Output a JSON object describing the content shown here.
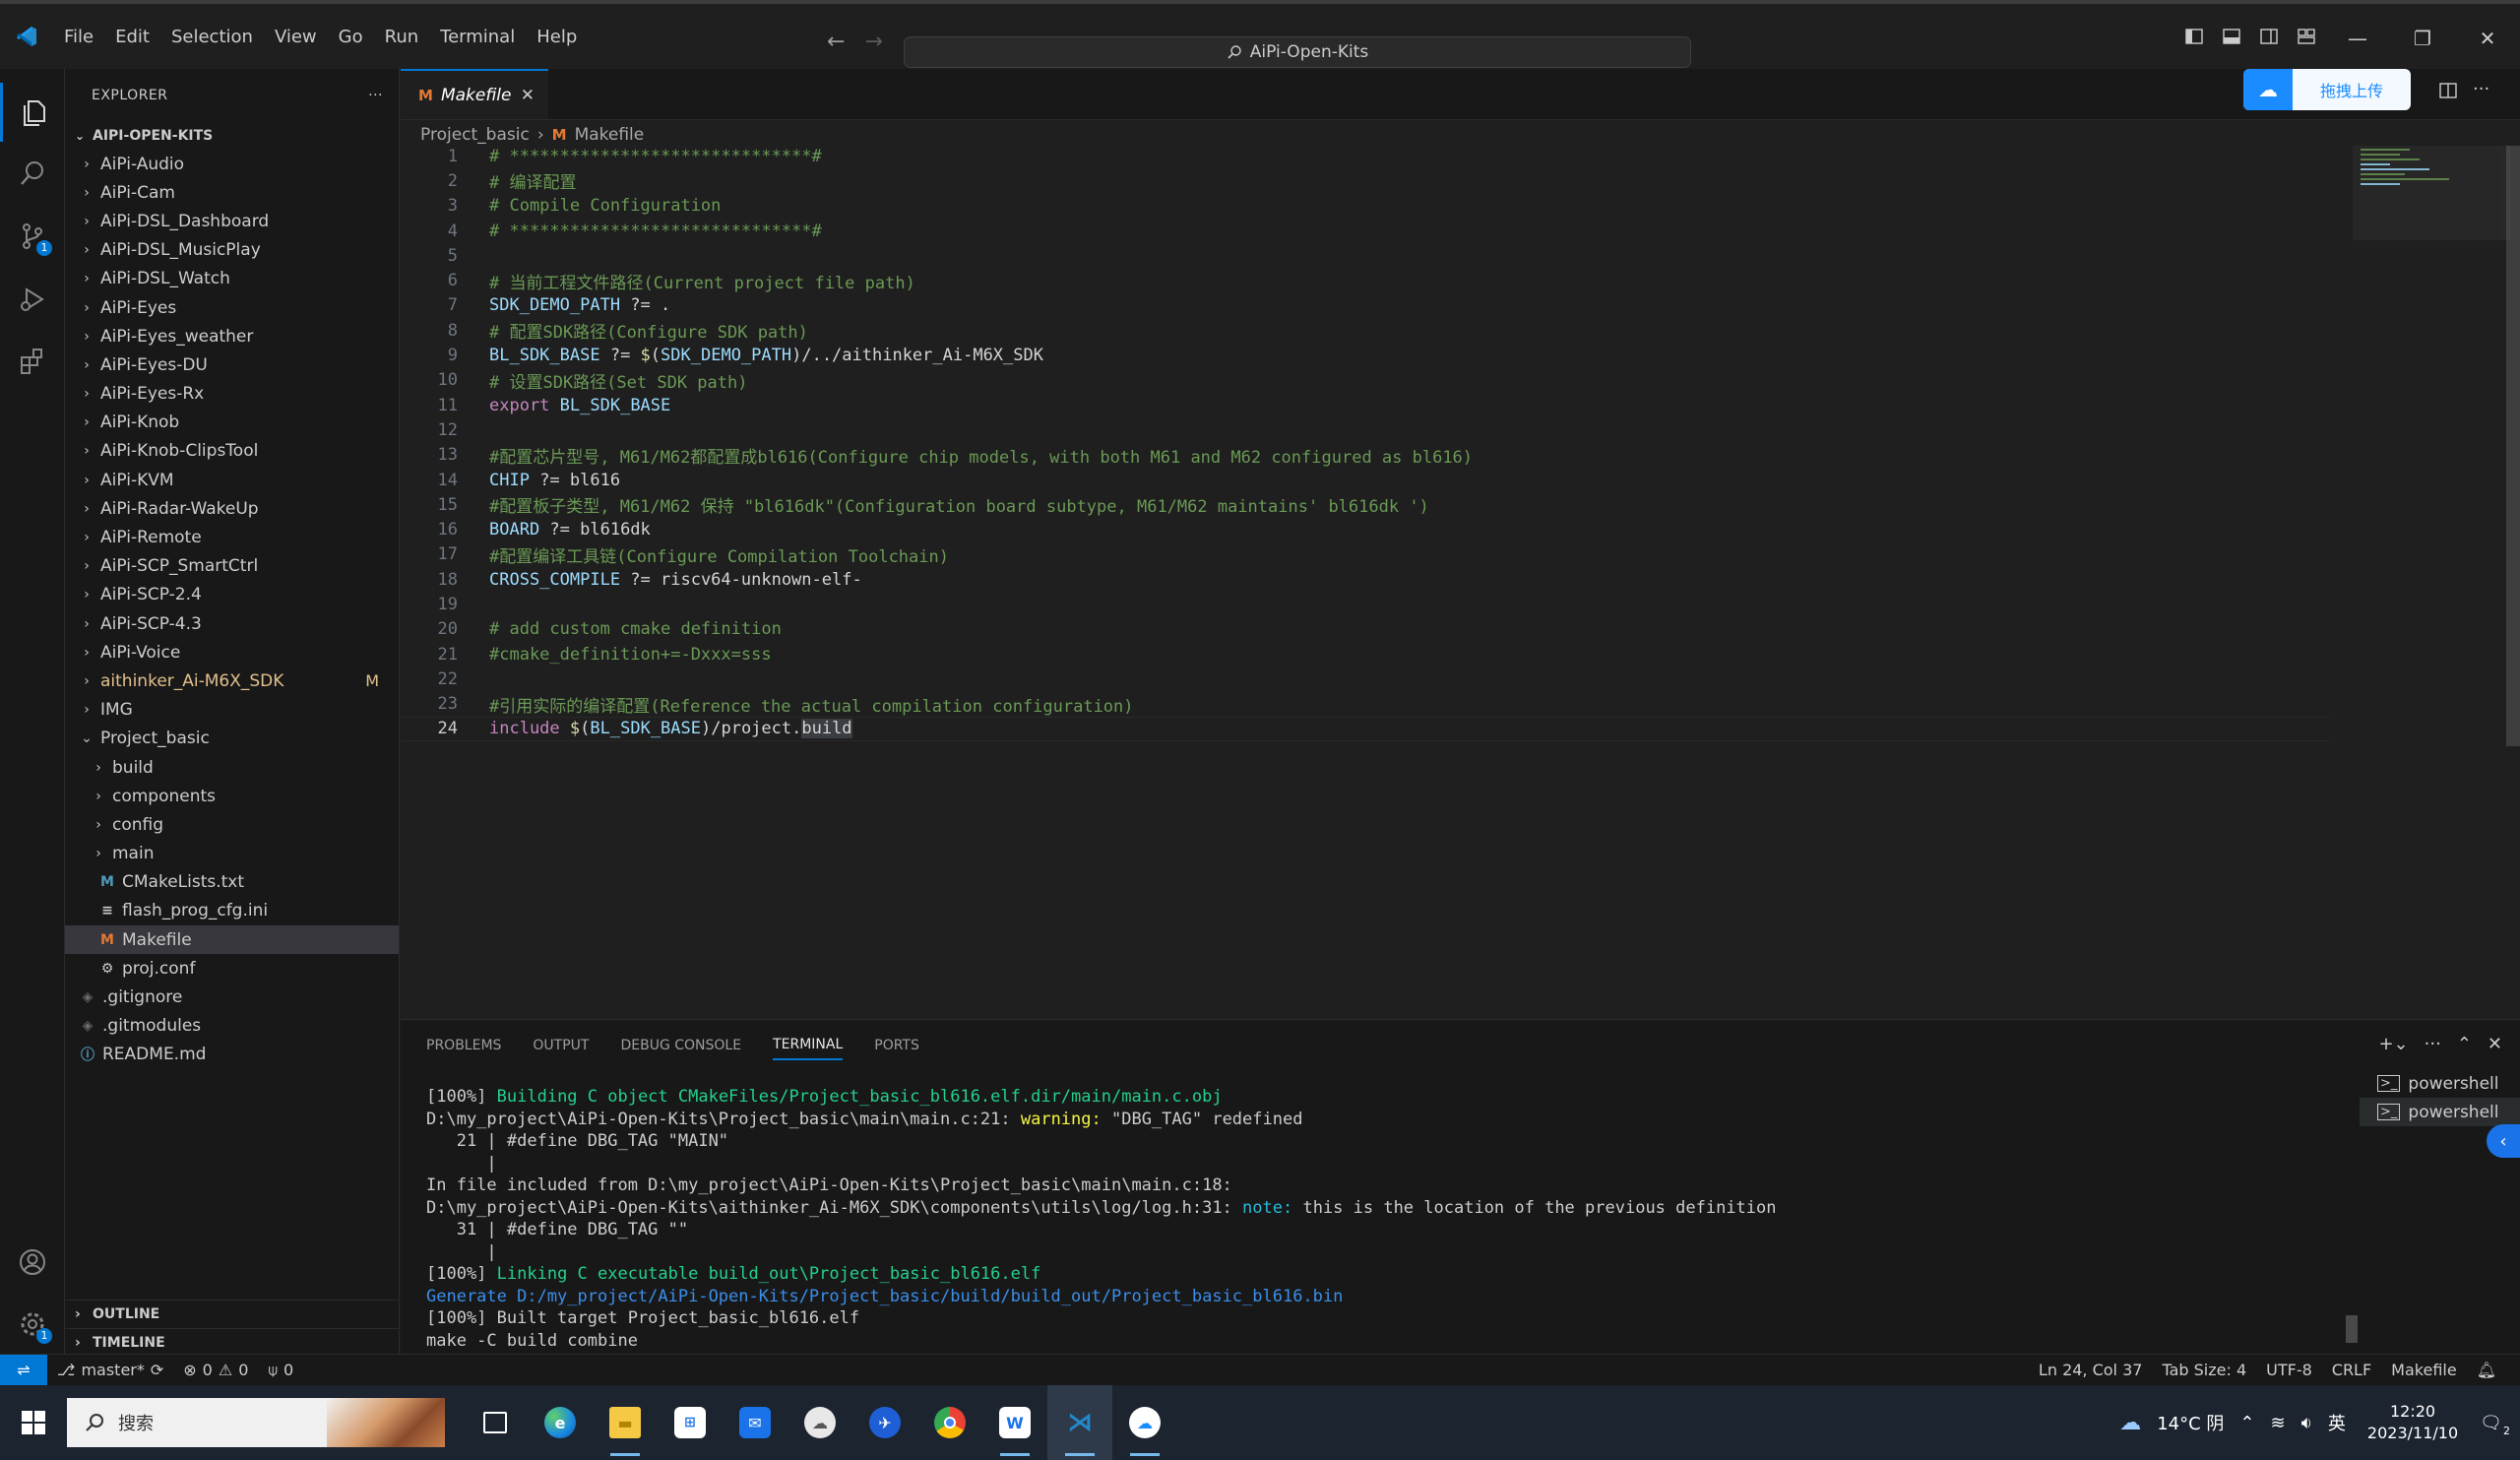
{
  "titlebar": {
    "menu": [
      "File",
      "Edit",
      "Selection",
      "View",
      "Go",
      "Run",
      "Terminal",
      "Help"
    ],
    "search": "AiPi-Open-Kits"
  },
  "activity": {
    "scm_badge": "1",
    "settings_badge": "1"
  },
  "explorer": {
    "title": "EXPLORER",
    "more": "···",
    "root": "AIPI-OPEN-KITS",
    "items": [
      {
        "label": "AiPi-Audio",
        "depth": 1,
        "type": "folder"
      },
      {
        "label": "AiPi-Cam",
        "depth": 1,
        "type": "folder"
      },
      {
        "label": "AiPi-DSL_Dashboard",
        "depth": 1,
        "type": "folder"
      },
      {
        "label": "AiPi-DSL_MusicPlay",
        "depth": 1,
        "type": "folder"
      },
      {
        "label": "AiPi-DSL_Watch",
        "depth": 1,
        "type": "folder"
      },
      {
        "label": "AiPi-Eyes",
        "depth": 1,
        "type": "folder"
      },
      {
        "label": "AiPi-Eyes_weather",
        "depth": 1,
        "type": "folder"
      },
      {
        "label": "AiPi-Eyes-DU",
        "depth": 1,
        "type": "folder"
      },
      {
        "label": "AiPi-Eyes-Rx",
        "depth": 1,
        "type": "folder"
      },
      {
        "label": "AiPi-Knob",
        "depth": 1,
        "type": "folder"
      },
      {
        "label": "AiPi-Knob-ClipsTool",
        "depth": 1,
        "type": "folder"
      },
      {
        "label": "AiPi-KVM",
        "depth": 1,
        "type": "folder"
      },
      {
        "label": "AiPi-Radar-WakeUp",
        "depth": 1,
        "type": "folder"
      },
      {
        "label": "AiPi-Remote",
        "depth": 1,
        "type": "folder"
      },
      {
        "label": "AiPi-SCP_SmartCtrl",
        "depth": 1,
        "type": "folder"
      },
      {
        "label": "AiPi-SCP-2.4",
        "depth": 1,
        "type": "folder"
      },
      {
        "label": "AiPi-SCP-4.3",
        "depth": 1,
        "type": "folder"
      },
      {
        "label": "AiPi-Voice",
        "depth": 1,
        "type": "folder"
      },
      {
        "label": "aithinker_Ai-M6X_SDK",
        "depth": 1,
        "type": "folder",
        "decoration": "M"
      },
      {
        "label": "IMG",
        "depth": 1,
        "type": "folder"
      },
      {
        "label": "Project_basic",
        "depth": 1,
        "type": "folder-open"
      },
      {
        "label": "build",
        "depth": 2,
        "type": "folder"
      },
      {
        "label": "components",
        "depth": 2,
        "type": "folder"
      },
      {
        "label": "config",
        "depth": 2,
        "type": "folder"
      },
      {
        "label": "main",
        "depth": 2,
        "type": "folder"
      },
      {
        "label": "CMakeLists.txt",
        "depth": 2,
        "type": "cmake"
      },
      {
        "label": "flash_prog_cfg.ini",
        "depth": 2,
        "type": "ini"
      },
      {
        "label": "Makefile",
        "depth": 2,
        "type": "makefile",
        "selected": true
      },
      {
        "label": "proj.conf",
        "depth": 2,
        "type": "conf"
      },
      {
        "label": ".gitignore",
        "depth": 1,
        "type": "git"
      },
      {
        "label": ".gitmodules",
        "depth": 1,
        "type": "git"
      },
      {
        "label": "README.md",
        "depth": 1,
        "type": "info"
      }
    ],
    "outline": "OUTLINE",
    "timeline": "TIMELINE"
  },
  "editor": {
    "tab_label": "Makefile",
    "tab_icon": "M",
    "breadcrumb": [
      "Project_basic",
      "Makefile"
    ],
    "upload_label": "拖拽上传",
    "lines": [
      [
        [
          "c",
          "# ******************************#"
        ]
      ],
      [
        [
          "c",
          "# 编译配置"
        ]
      ],
      [
        [
          "c",
          "# Compile Configuration"
        ]
      ],
      [
        [
          "c",
          "# ******************************#"
        ]
      ],
      [],
      [
        [
          "c",
          "# 当前工程文件路径(Current project file path)"
        ]
      ],
      [
        [
          "v",
          "SDK_DEMO_PATH"
        ],
        [
          "p",
          " ?= ."
        ]
      ],
      [
        [
          "c",
          "# 配置SDK路径(Configure SDK path)"
        ]
      ],
      [
        [
          "v",
          "BL_SDK_BASE"
        ],
        [
          "p",
          " ?= "
        ],
        [
          "d",
          "$"
        ],
        [
          "p",
          "("
        ],
        [
          "v",
          "SDK_DEMO_PATH"
        ],
        [
          "p",
          ")/../aithinker_Ai-M6X_SDK"
        ]
      ],
      [
        [
          "c",
          "# 设置SDK路径(Set SDK path)"
        ]
      ],
      [
        [
          "k",
          "export"
        ],
        [
          "p",
          " "
        ],
        [
          "v",
          "BL_SDK_BASE"
        ]
      ],
      [],
      [
        [
          "c",
          "#配置芯片型号, M61/M62都配置成bl616(Configure chip models, with both M61 and M62 configured as bl616)"
        ]
      ],
      [
        [
          "v",
          "CHIP"
        ],
        [
          "p",
          " ?= bl616"
        ]
      ],
      [
        [
          "c",
          "#配置板子类型, M61/M62 保持 \"bl616dk\"(Configuration board subtype, M61/M62 maintains' bl616dk ')"
        ]
      ],
      [
        [
          "v",
          "BOARD"
        ],
        [
          "p",
          " ?= bl616dk"
        ]
      ],
      [
        [
          "c",
          "#配置编译工具链(Configure Compilation Toolchain)"
        ]
      ],
      [
        [
          "v",
          "CROSS_COMPILE"
        ],
        [
          "p",
          " ?= riscv64-unknown-elf-"
        ]
      ],
      [],
      [
        [
          "c",
          "# add custom cmake definition"
        ]
      ],
      [
        [
          "c",
          "#cmake_definition+=-Dxxx=sss"
        ]
      ],
      [],
      [
        [
          "c",
          "#引用实际的编译配置(Reference the actual compilation configuration)"
        ]
      ],
      [
        [
          "k",
          "include"
        ],
        [
          "p",
          " "
        ],
        [
          "d",
          "$"
        ],
        [
          "p",
          "("
        ],
        [
          "v",
          "BL_SDK_BASE"
        ],
        [
          "p",
          ")/project."
        ],
        [
          "h",
          "build"
        ]
      ]
    ]
  },
  "panel": {
    "tabs": [
      "PROBLEMS",
      "OUTPUT",
      "DEBUG CONSOLE",
      "TERMINAL",
      "PORTS"
    ],
    "active_tab": "TERMINAL",
    "terminals": [
      "powershell",
      "powershell"
    ],
    "terminal_lines": [
      [
        [
          "p",
          "[100%] "
        ],
        [
          "g",
          "Building C object CMakeFiles/Project_basic_bl616.elf.dir/main/main.c.obj"
        ]
      ],
      [
        [
          "p",
          "D:\\my_project\\AiPi-Open-Kits\\Project_basic\\main\\main.c:21: "
        ],
        [
          "y",
          "warning: "
        ],
        [
          "p",
          "\"DBG_TAG\" redefined"
        ]
      ],
      [
        [
          "p",
          "   21 | #define DBG_TAG \"MAIN\""
        ]
      ],
      [
        [
          "p",
          "      |"
        ]
      ],
      [
        [
          "p",
          "In file included from D:\\my_project\\AiPi-Open-Kits\\Project_basic\\main\\main.c:18:"
        ]
      ],
      [
        [
          "p",
          "D:\\my_project\\AiPi-Open-Kits\\aithinker_Ai-M6X_SDK\\components\\utils\\log/log.h:31: "
        ],
        [
          "cy",
          "note: "
        ],
        [
          "p",
          "this is the location of the previous definition"
        ]
      ],
      [
        [
          "p",
          "   31 | #define DBG_TAG \"\""
        ]
      ],
      [
        [
          "p",
          "      |"
        ]
      ],
      [
        [
          "p",
          "[100%] "
        ],
        [
          "g",
          "Linking C executable build_out\\Project_basic_bl616.elf"
        ]
      ],
      [
        [
          "b",
          "Generate D:/my_project/AiPi-Open-Kits/Project_basic/build/build_out/Project_basic_bl616.bin"
        ]
      ],
      [
        [
          "p",
          "[100%] Built target Project_basic_bl616.elf"
        ]
      ],
      [
        [
          "p",
          "make -C build combine"
        ]
      ]
    ]
  },
  "statusbar": {
    "branch": "master*",
    "errors": "0",
    "warnings": "0",
    "ports": "0",
    "position": "Ln 24, Col 37",
    "tab_size": "Tab Size: 4",
    "encoding": "UTF-8",
    "eol": "CRLF",
    "language": "Makefile"
  },
  "taskbar": {
    "search_placeholder": "搜索",
    "weather": "14°C 阴",
    "ime": "英",
    "time": "12:20",
    "date": "2023/11/10",
    "notification_badge": "2"
  }
}
